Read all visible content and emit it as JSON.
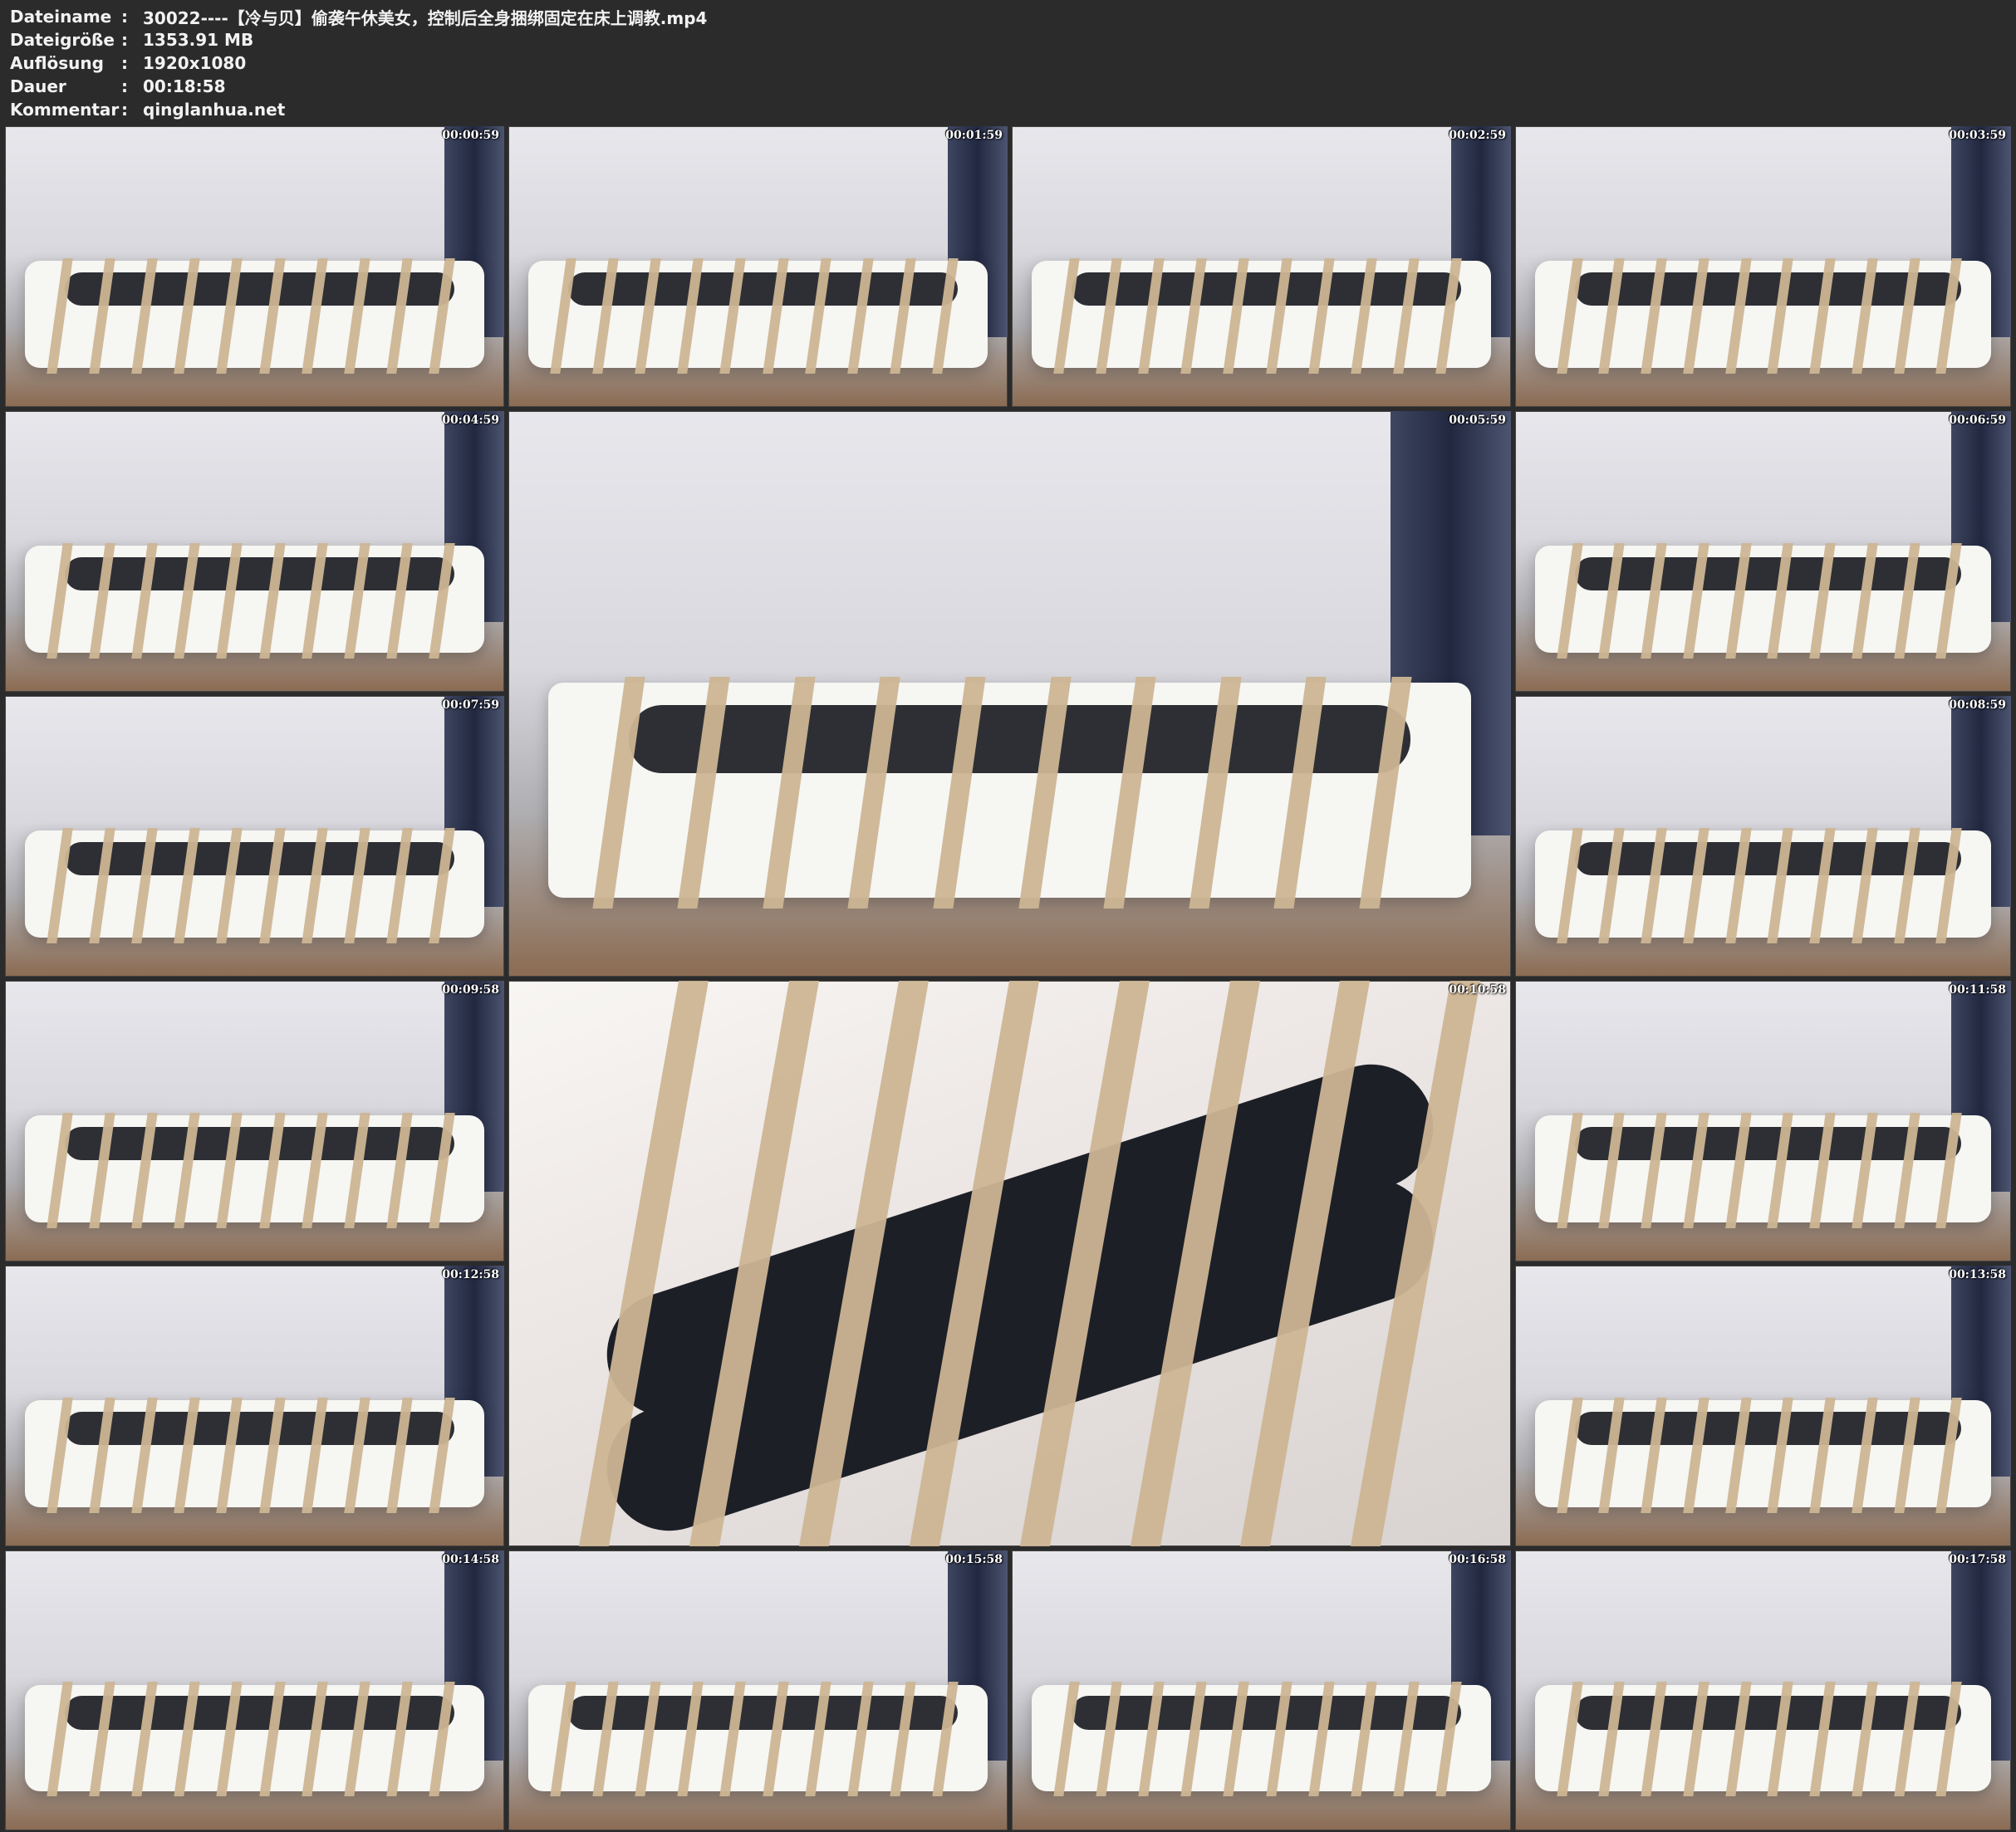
{
  "metadata": {
    "filename_label": "Dateiname",
    "filename_value": "30022----【冷与贝】偷袭午休美女，控制后全身捆绑固定在床上调教.mp4",
    "filesize_label": "Dateigröße",
    "filesize_value": "1353.91 MB",
    "resolution_label": "Auflösung",
    "resolution_value": "1920x1080",
    "duration_label": "Dauer",
    "duration_value": "00:18:58",
    "comment_label": "Kommentar",
    "comment_value": "qinglanhua.net",
    "separator": ":"
  },
  "thumbnails": [
    {
      "timestamp": "00:00:59",
      "type": "closeup"
    },
    {
      "timestamp": "00:01:59",
      "type": "wide"
    },
    {
      "timestamp": "00:02:59",
      "type": "closeup"
    },
    {
      "timestamp": "00:03:59",
      "type": "closeup"
    },
    {
      "timestamp": "00:04:59",
      "type": "wide"
    },
    {
      "timestamp": "00:05:59",
      "type": "wide"
    },
    {
      "timestamp": "00:06:59",
      "type": "wide"
    },
    {
      "timestamp": "00:07:59",
      "type": "wide"
    },
    {
      "timestamp": "00:08:59",
      "type": "wide"
    },
    {
      "timestamp": "00:09:58",
      "type": "wide"
    },
    {
      "timestamp": "00:10:58",
      "type": "closeup"
    },
    {
      "timestamp": "00:11:58",
      "type": "wide"
    },
    {
      "timestamp": "00:12:58",
      "type": "wide"
    },
    {
      "timestamp": "00:13:58",
      "type": "wide"
    },
    {
      "timestamp": "00:14:58",
      "type": "wide"
    },
    {
      "timestamp": "00:15:58",
      "type": "wide"
    },
    {
      "timestamp": "00:16:58",
      "type": "wide"
    },
    {
      "timestamp": "00:17:58",
      "type": "wide"
    }
  ]
}
